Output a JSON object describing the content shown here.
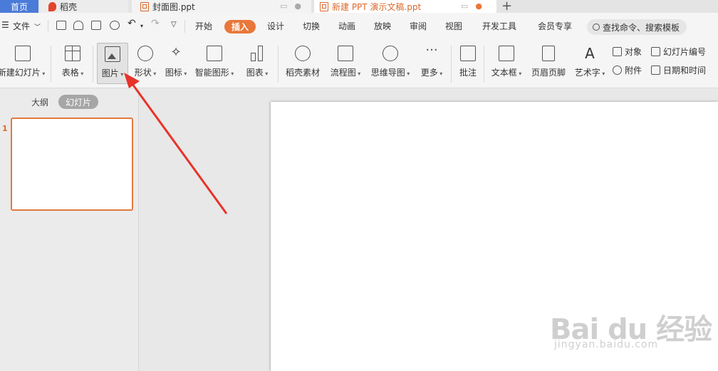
{
  "tabs": {
    "home": "首页",
    "daoke": "稻壳",
    "file1": "封面图.ppt",
    "file2": "新建 PPT 演示文稿.ppt"
  },
  "menu": {
    "file": "文件",
    "items": [
      "开始",
      "插入",
      "设计",
      "切换",
      "动画",
      "放映",
      "审阅",
      "视图",
      "开发工具",
      "会员专享"
    ],
    "search_placeholder": "查找命令、搜索模板"
  },
  "ribbon": {
    "new_slide": "新建幻灯片",
    "table": "表格",
    "picture": "图片",
    "shape": "形状",
    "icon": "图标",
    "smartart": "智能图形",
    "chart": "图表",
    "daoke_material": "稻壳素材",
    "flowchart": "流程图",
    "mindmap": "思维导图",
    "more": "更多",
    "comment": "批注",
    "textbox": "文本框",
    "header_footer": "页眉页脚",
    "wordart": "艺术字",
    "object": "对象",
    "slide_number": "幻灯片编号",
    "attachment": "附件",
    "date_time": "日期和时间"
  },
  "panel": {
    "outline": "大纲",
    "slides": "幻灯片",
    "slide_number": "1"
  },
  "watermark": {
    "main": "Bai du 经验",
    "sub": "jingyan.baidu.com"
  },
  "colors": {
    "accent": "#e9773a",
    "home_tab": "#4b7bd8",
    "arrow": "#e8332a"
  }
}
